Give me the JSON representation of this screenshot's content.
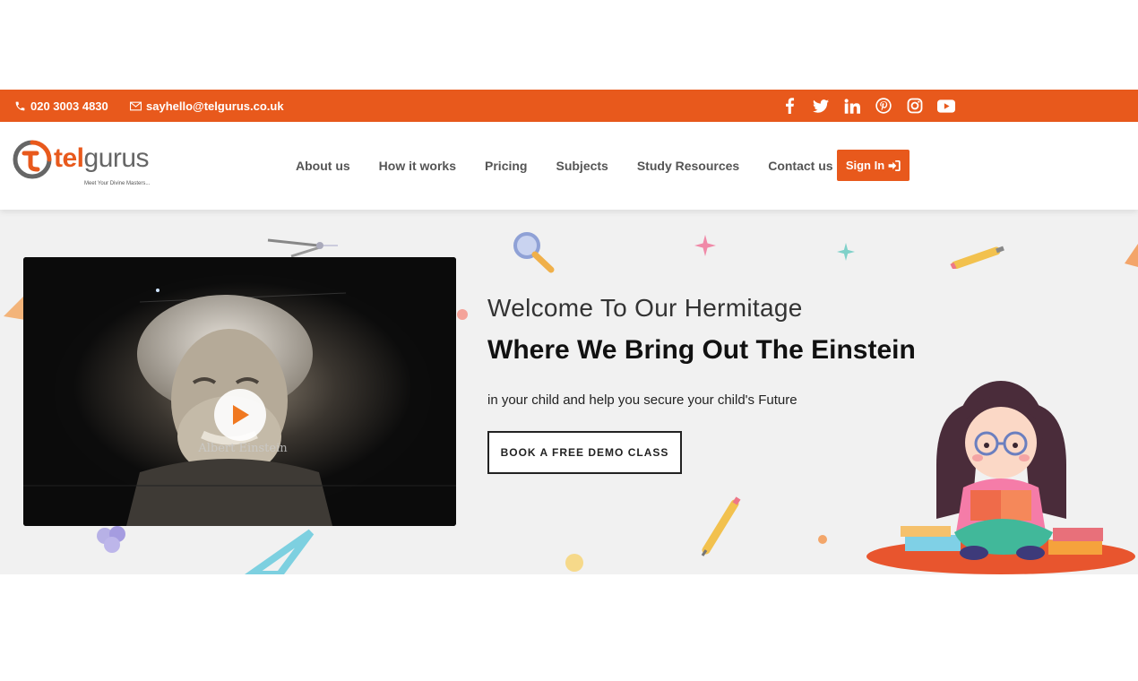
{
  "topbar": {
    "phone": "020 3003 4830",
    "email": "sayhello@telgurus.co.uk",
    "social_icons": [
      "facebook-icon",
      "twitter-icon",
      "linkedin-icon",
      "pinterest-icon",
      "instagram-icon",
      "youtube-icon"
    ],
    "bg_color": "#e8591c"
  },
  "logo": {
    "part1": "tel",
    "part2": "gurus",
    "tagline": "Meet Your Divine Masters..."
  },
  "nav": {
    "items": [
      {
        "label": "About us"
      },
      {
        "label": "How it works"
      },
      {
        "label": "Pricing"
      },
      {
        "label": "Subjects"
      },
      {
        "label": "Study Resources"
      },
      {
        "label": "Contact us"
      }
    ],
    "signin_label": "Sign In"
  },
  "hero": {
    "video": {
      "caption": "Albert Einstein",
      "play_icon": "play-icon"
    },
    "welcome": "Welcome To Our Hermitage",
    "headline": "Where We Bring Out The Einstein",
    "subline": "in your child and help you secure your child's Future",
    "cta_label": "BOOK A FREE DEMO CLASS"
  },
  "colors": {
    "accent": "#e8591c",
    "hero_bg": "#f1f1f1"
  }
}
